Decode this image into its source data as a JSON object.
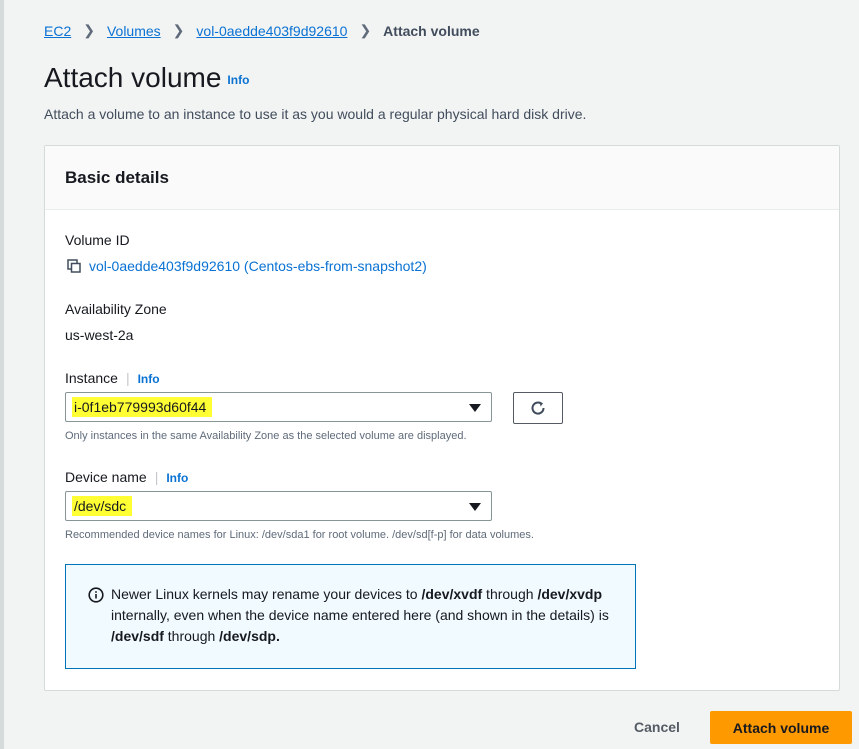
{
  "breadcrumb": {
    "items": [
      "EC2",
      "Volumes",
      "vol-0aedde403f9d92610"
    ],
    "current": "Attach volume"
  },
  "header": {
    "title": "Attach volume",
    "info": "Info",
    "subtitle": "Attach a volume to an instance to use it as you would a regular physical hard disk drive."
  },
  "panel": {
    "title": "Basic details",
    "volume_id": {
      "label": "Volume ID",
      "value": "vol-0aedde403f9d92610 (Centos-ebs-from-snapshot2)"
    },
    "availability_zone": {
      "label": "Availability Zone",
      "value": "us-west-2a"
    },
    "instance": {
      "label": "Instance",
      "info": "Info",
      "value": "i-0f1eb779993d60f44",
      "hint": "Only instances in the same Availability Zone as the selected volume are displayed."
    },
    "device_name": {
      "label": "Device name",
      "info": "Info",
      "value": "/dev/sdc",
      "hint": "Recommended device names for Linux: /dev/sda1 for root volume. /dev/sd[f-p] for data volumes."
    },
    "alert": {
      "t1": "Newer Linux kernels may rename your devices to ",
      "b1": "/dev/xvdf",
      "t2": " through ",
      "b2": "/dev/xvdp",
      "t3": " internally, even when the device name entered here (and shown in the details) is ",
      "b3": "/dev/sdf",
      "t4": " through ",
      "b4": "/dev/sdp."
    }
  },
  "footer": {
    "cancel": "Cancel",
    "attach": "Attach volume"
  }
}
